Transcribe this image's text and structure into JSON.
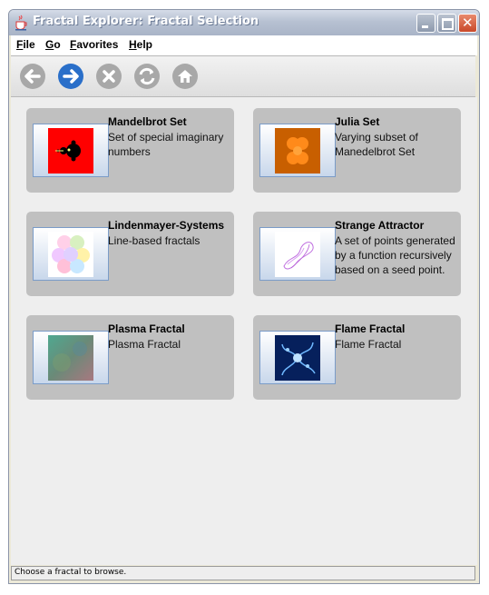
{
  "window": {
    "title": "Fractal Explorer: Fractal Selection",
    "controls": {
      "minimize": "minimize-icon",
      "maximize": "maximize-icon",
      "close": "close-icon"
    }
  },
  "menu": {
    "items": [
      {
        "label": "File"
      },
      {
        "label": "Go"
      },
      {
        "label": "Favorites"
      },
      {
        "label": "Help"
      }
    ]
  },
  "toolbar": {
    "buttons": [
      {
        "name": "back-button",
        "icon": "arrow-left-icon",
        "enabled": false
      },
      {
        "name": "forward-button",
        "icon": "arrow-right-icon",
        "enabled": true
      },
      {
        "name": "stop-button",
        "icon": "x-icon",
        "enabled": false
      },
      {
        "name": "refresh-button",
        "icon": "refresh-icon",
        "enabled": false
      },
      {
        "name": "home-button",
        "icon": "home-icon",
        "enabled": false
      }
    ],
    "colors": {
      "enabled": "#2a6fc9",
      "disabled": "#a8a8a8"
    }
  },
  "fractals": [
    {
      "title": "Mandelbrot Set",
      "desc": "Set of special imaginary numbers",
      "thumb": "mandelbrot-thumbnail"
    },
    {
      "title": "Julia Set",
      "desc": "Varying subset of Manedelbrot Set",
      "thumb": "julia-thumbnail"
    },
    {
      "title": "Lindenmayer-Systems",
      "desc": "Line-based fractals",
      "thumb": "lsystem-thumbnail"
    },
    {
      "title": "Strange Attractor",
      "desc": "A set of points generated by a function recursively based on a seed point.",
      "thumb": "attractor-thumbnail"
    },
    {
      "title": "Plasma Fractal",
      "desc": "Plasma Fractal",
      "thumb": "plasma-thumbnail"
    },
    {
      "title": "Flame Fractal",
      "desc": "Flame Fractal",
      "thumb": "flame-thumbnail"
    }
  ],
  "status": {
    "text": "Choose a fractal to browse."
  }
}
